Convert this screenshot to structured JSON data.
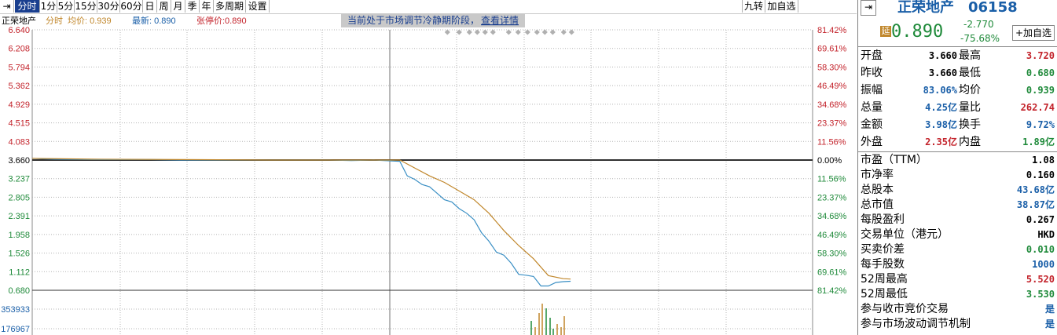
{
  "toolbar": {
    "items": [
      "分时",
      "1分",
      "5分",
      "15分",
      "30分",
      "60分",
      "日",
      "周",
      "月",
      "季",
      "年",
      "多周期",
      "设置"
    ],
    "active": "分时",
    "right_items": [
      "九转",
      "加自选"
    ]
  },
  "notice": {
    "text": "当前处于市场调节冷静期阶段，",
    "link": "查看详情"
  },
  "legend": {
    "name": "正荣地产",
    "mode": "分时",
    "avg_label": "均价: 0.939",
    "last_label": "最新: 0.890",
    "limit_label": "张停价:0.890"
  },
  "colors": {
    "price": "#3a8fc4",
    "avg": "#c0862a",
    "up": "#c3232b",
    "down": "#1f8a3a",
    "grid": "#b4b4b4",
    "vol_up": "#c0862a",
    "vol_down": "#1f8a3a"
  },
  "chart_data": {
    "type": "line",
    "prev_close": 3.66,
    "y_ticks": [
      "6.640",
      "6.208",
      "5.794",
      "5.362",
      "4.929",
      "4.515",
      "4.083",
      "3.660",
      "3.237",
      "2.805",
      "2.391",
      "1.958",
      "1.526",
      "1.112",
      "0.680"
    ],
    "pct_ticks": [
      "81.42%",
      "69.61%",
      "58.30%",
      "46.49%",
      "34.68%",
      "23.37%",
      "11.56%",
      "0.00%",
      "11.56%",
      "23.37%",
      "34.68%",
      "46.49%",
      "58.30%",
      "69.61%",
      "81.42%"
    ],
    "ylim": [
      0.68,
      6.64
    ],
    "volume_ticks": [
      "353933",
      "176967"
    ],
    "series": [
      {
        "name": "最新",
        "points": [
          [
            0,
            3.7
          ],
          [
            10,
            3.69
          ],
          [
            30,
            3.68
          ],
          [
            80,
            3.67
          ],
          [
            160,
            3.67
          ],
          [
            200,
            3.66
          ],
          [
            320,
            3.66
          ],
          [
            400,
            3.66
          ],
          [
            430,
            3.65
          ],
          [
            460,
            3.66
          ],
          [
            495,
            3.63
          ],
          [
            505,
            3.3
          ],
          [
            515,
            3.22
          ],
          [
            525,
            3.1
          ],
          [
            535,
            3.05
          ],
          [
            545,
            2.9
          ],
          [
            555,
            2.75
          ],
          [
            565,
            2.7
          ],
          [
            575,
            2.55
          ],
          [
            585,
            2.45
          ],
          [
            595,
            2.3
          ],
          [
            605,
            2.0
          ],
          [
            615,
            1.8
          ],
          [
            625,
            1.55
          ],
          [
            635,
            1.48
          ],
          [
            645,
            1.3
          ],
          [
            655,
            1.05
          ],
          [
            665,
            1.03
          ],
          [
            675,
            1.0
          ],
          [
            685,
            0.78
          ],
          [
            695,
            0.78
          ],
          [
            705,
            0.86
          ],
          [
            715,
            0.88
          ],
          [
            725,
            0.89
          ]
        ]
      },
      {
        "name": "均价",
        "points": [
          [
            0,
            3.7
          ],
          [
            80,
            3.68
          ],
          [
            200,
            3.67
          ],
          [
            320,
            3.66
          ],
          [
            400,
            3.66
          ],
          [
            495,
            3.66
          ],
          [
            515,
            3.48
          ],
          [
            535,
            3.3
          ],
          [
            555,
            3.15
          ],
          [
            575,
            2.95
          ],
          [
            595,
            2.75
          ],
          [
            615,
            2.45
          ],
          [
            635,
            2.05
          ],
          [
            655,
            1.7
          ],
          [
            675,
            1.4
          ],
          [
            695,
            1.02
          ],
          [
            715,
            0.95
          ],
          [
            725,
            0.94
          ]
        ]
      }
    ],
    "volume": [
      {
        "x": 676,
        "v": 0.45,
        "up": false
      },
      {
        "x": 681,
        "v": 0.25,
        "up": true
      },
      {
        "x": 686,
        "v": 0.7,
        "up": true
      },
      {
        "x": 690,
        "v": 1.0,
        "up": true
      },
      {
        "x": 695,
        "v": 0.85,
        "up": false
      },
      {
        "x": 700,
        "v": 0.55,
        "up": false
      },
      {
        "x": 704,
        "v": 0.2,
        "up": false
      },
      {
        "x": 709,
        "v": 0.35,
        "up": true
      },
      {
        "x": 714,
        "v": 0.25,
        "up": true
      },
      {
        "x": 718,
        "v": 0.6,
        "up": true
      }
    ]
  },
  "quote": {
    "name": "正荣地产",
    "code": "06158",
    "badge": "延",
    "price": "0.890",
    "change": "-2.770",
    "change_pct": "-75.68%",
    "watch_button": "+加自选",
    "rows": [
      {
        "l1": "开盘",
        "v1": "3.660",
        "c1": "#000",
        "l2": "最高",
        "v2": "3.720",
        "c2": "#c3232b"
      },
      {
        "l1": "昨收",
        "v1": "3.660",
        "c1": "#000",
        "l2": "最低",
        "v2": "0.680",
        "c2": "#1f8a3a"
      },
      {
        "l1": "振幅",
        "v1": "83.06%",
        "c1": "#1a5fa8",
        "l2": "均价",
        "v2": "0.939",
        "c2": "#1f8a3a"
      },
      {
        "l1": "总量",
        "v1": "4.25亿",
        "c1": "#1a5fa8",
        "l2": "量比",
        "v2": "262.74",
        "c2": "#c3232b"
      },
      {
        "l1": "金额",
        "v1": "3.98亿",
        "c1": "#1a5fa8",
        "l2": "换手",
        "v2": "9.72%",
        "c2": "#1a5fa8"
      },
      {
        "l1": "外盘",
        "v1": "2.35亿",
        "c1": "#c3232b",
        "l2": "内盘",
        "v2": "1.89亿",
        "c2": "#1f8a3a"
      }
    ],
    "stats": [
      {
        "label": "市盈（TTM）",
        "value": "1.08",
        "color": "#000"
      },
      {
        "label": "市净率",
        "value": "0.160",
        "color": "#000"
      },
      {
        "label": "总股本",
        "value": "43.68亿",
        "color": "#1a5fa8"
      },
      {
        "label": "总市值",
        "value": "38.87亿",
        "color": "#1a5fa8"
      },
      {
        "label": "每股盈利",
        "value": "0.267",
        "color": "#000"
      },
      {
        "label": "交易单位（港元）",
        "value": "HKD",
        "color": "#000"
      },
      {
        "label": "买卖价差",
        "value": "0.010",
        "color": "#1f8a3a"
      },
      {
        "label": "每手股数",
        "value": "1000",
        "color": "#1a5fa8"
      },
      {
        "label": "52周最高",
        "value": "5.520",
        "color": "#c3232b"
      },
      {
        "label": "52周最低",
        "value": "3.530",
        "color": "#1f8a3a"
      },
      {
        "label": "参与收市竞价交易",
        "value": "是",
        "color": "#1a5fa8"
      },
      {
        "label": "参与市场波动调节机制",
        "value": "是",
        "color": "#1a5fa8"
      }
    ]
  }
}
